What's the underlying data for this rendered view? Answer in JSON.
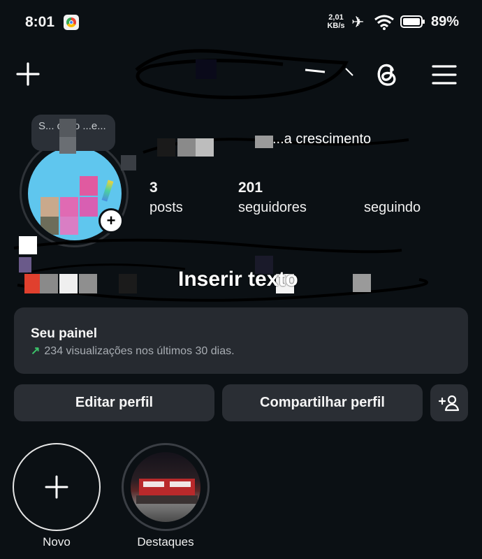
{
  "status_bar": {
    "time": "8:01",
    "net_speed_value": "2,01",
    "net_speed_unit": "KB/s",
    "battery": "89%"
  },
  "header": {
    "icons": [
      "plus-icon",
      "threads-icon",
      "menu-icon"
    ]
  },
  "profile": {
    "note_text": "S... curio ...e...",
    "masked_title": "...a crescimento",
    "stats": [
      {
        "value": "3",
        "label": "posts"
      },
      {
        "value": "201",
        "label": "seguidores"
      },
      {
        "value": "",
        "label": "seguindo"
      }
    ],
    "bio_overlay": "Inserir texto"
  },
  "dashboard": {
    "title": "Seu painel",
    "subtitle": "234 visualizações nos últimos 30 dias.",
    "trend_color": "#3cc36a"
  },
  "buttons": {
    "edit": "Editar perfil",
    "share": "Compartilhar perfil"
  },
  "highlights": [
    {
      "label": "Novo"
    },
    {
      "label": "Destaques"
    }
  ]
}
